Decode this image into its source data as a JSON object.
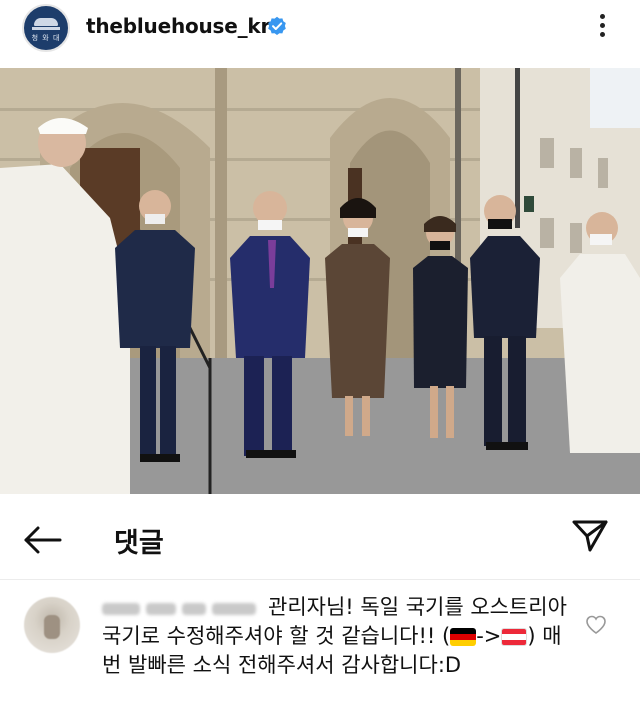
{
  "header": {
    "username": "thebluehouse_kr",
    "verified_icon": "verified-badge-icon",
    "avatar_text": "청 와 대",
    "more_icon": "more-vertical-icon"
  },
  "post": {
    "photo": "photo of dignitaries standing in front of an abbey church"
  },
  "comments": {
    "title": "댓글",
    "back_icon": "arrow-left-icon",
    "send_icon": "send-icon"
  },
  "comment": {
    "text_part1": "관리자님! 독일 국기를 오스트리아 국기로 수정해주셔야 할 것 같습니다!! (",
    "arrow": "->",
    "text_part2": ") 매번 발빠른 소식 전해주셔서 감사합니다:D",
    "flag_from": "germany-flag-icon",
    "flag_to": "austria-flag-icon",
    "like_icon": "heart-outline-icon"
  },
  "colors": {
    "verified": "#3897f0",
    "text": "#111111",
    "flag_de": [
      "#000000",
      "#dd0000",
      "#ffce00"
    ],
    "flag_at": [
      "#ed2939",
      "#ffffff",
      "#ed2939"
    ]
  }
}
